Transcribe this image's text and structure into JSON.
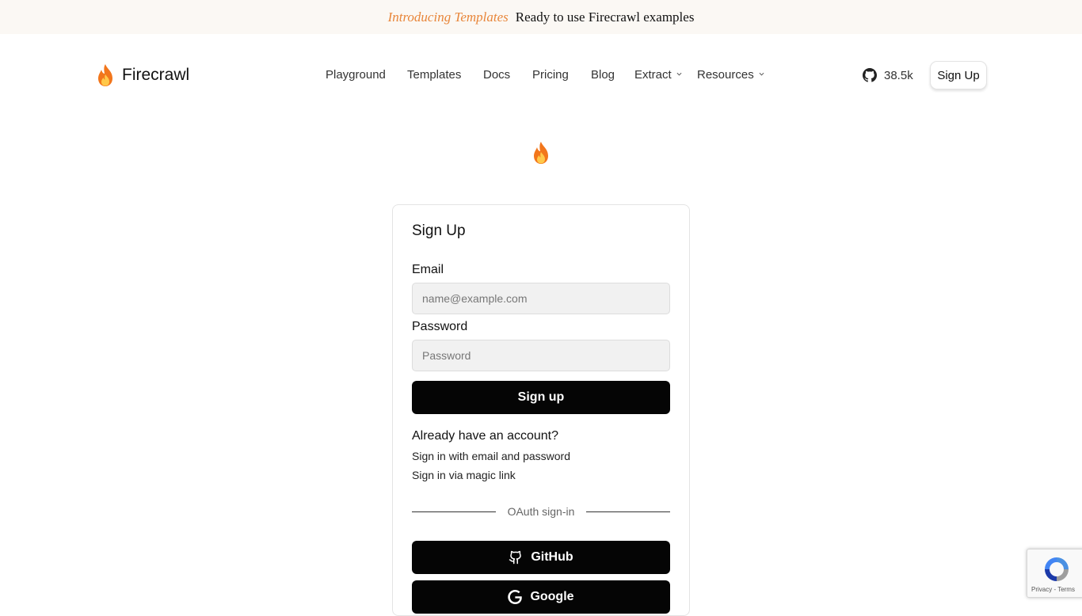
{
  "banner": {
    "promo": "Introducing Templates",
    "tagline": "Ready to use Firecrawl examples"
  },
  "header": {
    "logo_icon": "fire-icon",
    "brand": "Firecrawl",
    "nav": [
      {
        "label": "Playground"
      },
      {
        "label": "Templates"
      },
      {
        "label": "Docs"
      },
      {
        "label": "Pricing"
      },
      {
        "label": "Blog"
      },
      {
        "label": "Extract",
        "dropdown": true
      },
      {
        "label": "Resources",
        "dropdown": true
      }
    ],
    "github_icon": "github-icon",
    "github_stars": "38.5k",
    "signup_label": "Sign Up"
  },
  "center_icon": "fire-icon",
  "form": {
    "title": "Sign Up",
    "email_label": "Email",
    "email_placeholder": "name@example.com",
    "email_value": "",
    "password_label": "Password",
    "password_placeholder": "Password",
    "password_value": "",
    "submit_label": "Sign up",
    "already": "Already have an account?",
    "signin_email": "Sign in with email and password",
    "signin_magic": "Sign in via magic link",
    "oauth_divider": "OAuth sign-in",
    "github_label": "GitHub",
    "google_label": "Google"
  },
  "recaptcha": {
    "links": "Privacy - Terms"
  },
  "colors": {
    "accent": "#e8863a",
    "banner_bg": "#fbf8f4",
    "button_bg": "#050505",
    "input_bg": "#f1f1f1"
  }
}
